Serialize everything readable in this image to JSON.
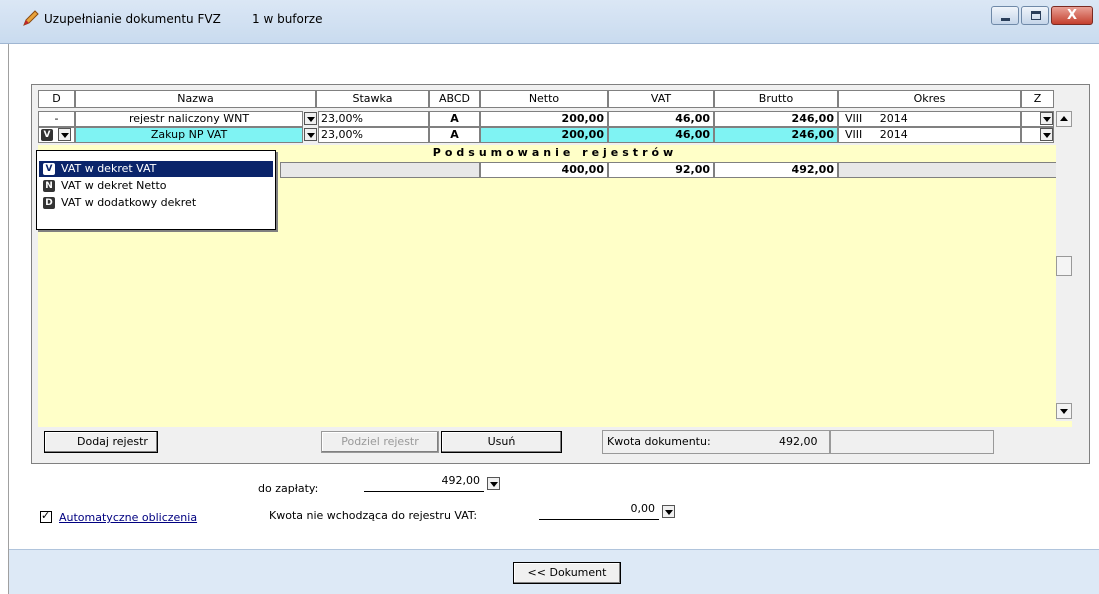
{
  "window": {
    "title": "Uzupełnianie dokumentu FVZ",
    "buffer": "1 w buforze",
    "close_glyph": "X"
  },
  "grid": {
    "columns": [
      "D",
      "Nazwa",
      "Stawka",
      "ABCD",
      "Netto",
      "VAT",
      "Brutto",
      "Okres",
      "Z"
    ],
    "rows": [
      {
        "d": "-",
        "nazwa": "rejestr naliczony WNT",
        "stawka": "23,00%",
        "abcd": "A",
        "netto": "200,00",
        "vat": "46,00",
        "brutto": "246,00",
        "okres_m": "VIII",
        "okres_y": "2014"
      },
      {
        "d": "V",
        "nazwa": "Zakup NP VAT",
        "stawka": "23,00%",
        "abcd": "A",
        "netto": "200,00",
        "vat": "46,00",
        "brutto": "246,00",
        "okres_m": "VIII",
        "okres_y": "2014"
      }
    ],
    "summary": {
      "title": "Podsumowanie rejestrów",
      "netto": "400,00",
      "vat": "92,00",
      "brutto": "492,00"
    }
  },
  "popup": {
    "items": [
      {
        "badge": "V",
        "label": "VAT w dekret VAT",
        "selected": true
      },
      {
        "badge": "N",
        "label": "VAT w dekret Netto",
        "selected": false
      },
      {
        "badge": "D",
        "label": "VAT w dodatkowy dekret",
        "selected": false
      }
    ]
  },
  "buttons": {
    "add": "Dodaj rejestr",
    "split": "Podziel rejestr",
    "delete": "Usuń",
    "doc": "<< Dokument"
  },
  "info": {
    "kwota_label": "Kwota dokumentu:",
    "kwota_value": "492,00"
  },
  "footer": {
    "auto_calc": "Automatyczne obliczenia",
    "to_pay_label": "do zapłaty:",
    "to_pay_value": "492,00",
    "non_vat_label": "Kwota nie wchodząca do rejestru VAT:",
    "non_vat_value": "0,00"
  }
}
